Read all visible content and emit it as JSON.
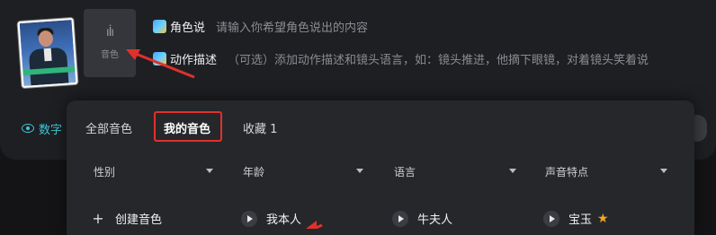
{
  "composer": {
    "voice_tile_label": "音色",
    "role_say": {
      "title": "角色说",
      "hint": "请输入你希望角色说出的内容"
    },
    "action_desc": {
      "title": "动作描述",
      "hint": "（可选）添加动作描述和镜头语言，如：镜头推进，他摘下眼镜，对着镜头笑着说"
    },
    "digital_button_label": "数字"
  },
  "voice_panel": {
    "tabs": [
      "全部音色",
      "我的音色",
      "收藏 1"
    ],
    "active_tab_index": 1,
    "filters": [
      "性别",
      "年龄",
      "语言",
      "声音特点"
    ],
    "items": [
      {
        "label": "创建音色",
        "icon": "plus-icon"
      },
      {
        "label": "我本人",
        "icon": "play-icon"
      },
      {
        "label": "牛夫人",
        "icon": "play-icon"
      },
      {
        "label": "宝玉",
        "icon": "play-icon",
        "badge_icon": "star-icon"
      }
    ]
  },
  "colors": {
    "accent_teal": "#3ec7d8",
    "highlight_red": "#e0312b",
    "star": "#f5a623"
  }
}
